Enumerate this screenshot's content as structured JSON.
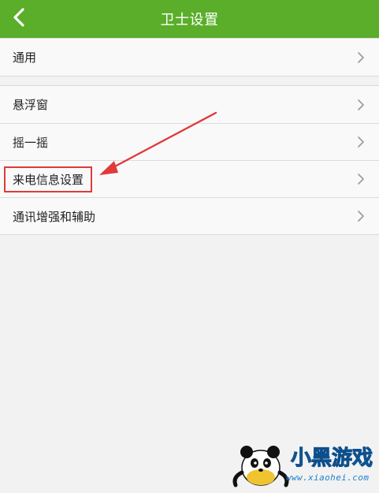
{
  "header": {
    "title": "卫士设置",
    "bg_color": "#5aae2a"
  },
  "groups": [
    {
      "items": [
        {
          "label": "通用"
        }
      ]
    },
    {
      "items": [
        {
          "label": "悬浮窗"
        },
        {
          "label": "摇一摇"
        },
        {
          "label": "来电信息设置"
        },
        {
          "label": "通讯增强和辅助"
        }
      ]
    }
  ],
  "annotation": {
    "highlighted_item": "来电信息设置",
    "color": "#e03a3a"
  },
  "watermark": {
    "logo_text": "小黑游戏",
    "url": "www.xiaohei.com"
  }
}
